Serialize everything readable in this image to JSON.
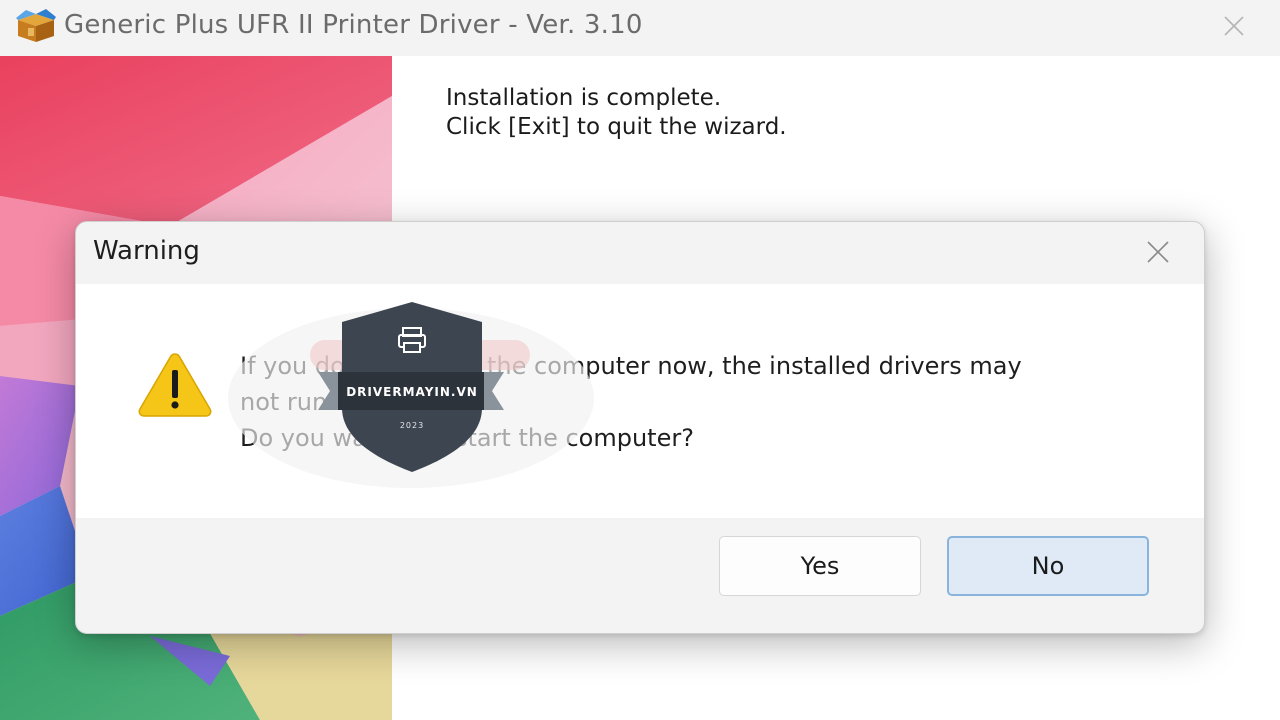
{
  "window": {
    "title": "Generic Plus UFR II Printer Driver - Ver. 3.10",
    "icon": "package-box-icon",
    "close_icon": "close-icon"
  },
  "installer": {
    "line1": "Installation is complete.",
    "line2": "Click [Exit] to quit the wizard."
  },
  "dialog": {
    "title": "Warning",
    "icon": "warning-triangle-icon",
    "message_line1": "If you do not restart the computer now, the installed drivers may",
    "message_line2": "not run correctly.",
    "message_line3": "Do you want to restart the computer?",
    "yes_label": "Yes",
    "no_label": "No"
  },
  "watermark": {
    "brand": "DRIVERMAYIN.VN",
    "year": "2023",
    "icon": "printer-icon"
  },
  "colors": {
    "accent": "#89b4dc",
    "warning": "#f5c518",
    "shield": "#3d4550"
  }
}
